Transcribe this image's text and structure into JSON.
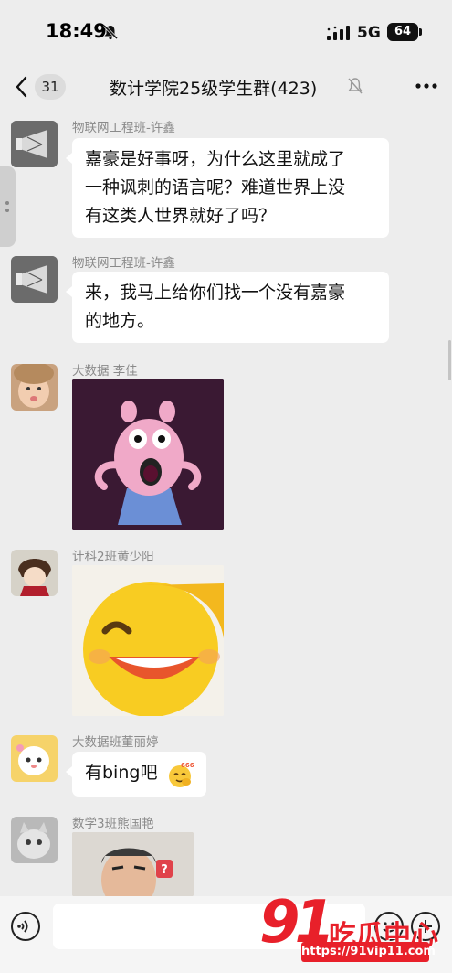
{
  "status_bar": {
    "time": "18:49",
    "network": "5G",
    "battery": "64"
  },
  "nav": {
    "unread_count": "31",
    "title": "数计学院25级学生群(423)"
  },
  "messages": [
    {
      "sender": "物联网工程班-许鑫",
      "lines": [
        "嘉豪是好事呀，为什么这里就成了",
        "一种讽刺的语言呢？难道世界上没",
        "有这类人世界就好了吗？"
      ]
    },
    {
      "sender": "物联网工程班-许鑫",
      "lines": [
        "来，我马上给你们找一个没有嘉豪",
        "的地方。"
      ]
    },
    {
      "sender": "大数据 李佳",
      "sticker": "peppa-pig-shocked-sticker"
    },
    {
      "sender": "计科2班黄少阳",
      "sticker": "laughing-emoji-sticker"
    },
    {
      "sender": "大数据班董丽婷",
      "text": "有bing吧",
      "emoji_badge": "666"
    },
    {
      "sender": "数学3班熊国艳",
      "sticker": "man-photo-sticker",
      "sticker_badge": "?"
    }
  ],
  "watermark": {
    "number": "91",
    "label": "吃瓜中心",
    "url": "https://91vip11.com"
  },
  "colors": {
    "background": "#ededed",
    "bubble": "#ffffff",
    "watermark": "#e8202a"
  }
}
